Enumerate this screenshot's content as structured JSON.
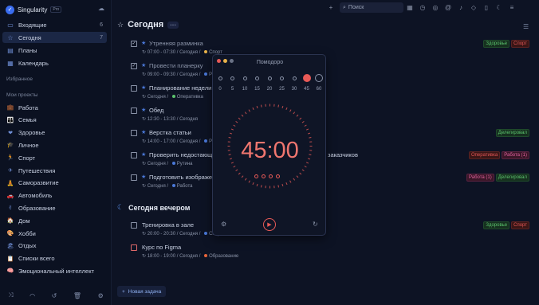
{
  "app": {
    "name": "Singularity",
    "badge": "Pro"
  },
  "sidebar": {
    "nav": [
      {
        "icon": "inbox-icon",
        "glyph": "▭",
        "label": "Входящие",
        "count": "6"
      },
      {
        "icon": "star-icon",
        "glyph": "☆",
        "label": "Сегодня",
        "count": "7"
      },
      {
        "icon": "plans-icon",
        "glyph": "▤",
        "label": "Планы",
        "count": ""
      },
      {
        "icon": "calendar-icon",
        "glyph": "▦",
        "label": "Календарь",
        "count": ""
      }
    ],
    "favorites_label": "Избранное",
    "projects_label": "Мои проекты",
    "projects": [
      {
        "icon": "briefcase-emoji",
        "glyph": "💼",
        "label": "Работа"
      },
      {
        "icon": "family-emoji",
        "glyph": "👪",
        "label": "Семья"
      },
      {
        "icon": "heart-emoji",
        "glyph": "❤",
        "label": "Здоровье"
      },
      {
        "icon": "hat-emoji",
        "glyph": "🎓",
        "label": "Личное"
      },
      {
        "icon": "sport-emoji",
        "glyph": "🏃",
        "label": "Спорт"
      },
      {
        "icon": "plane-emoji",
        "glyph": "✈",
        "label": "Путешествия"
      },
      {
        "icon": "selfdev-emoji",
        "glyph": "🧘",
        "label": "Саморазвитие"
      },
      {
        "icon": "car-emoji",
        "glyph": "🚗",
        "label": "Автомобиль"
      },
      {
        "icon": "hand-emoji",
        "glyph": "✌",
        "label": "Образование"
      },
      {
        "icon": "house-emoji",
        "glyph": "🏠",
        "label": "Дом"
      },
      {
        "icon": "palette-emoji",
        "glyph": "🎨",
        "label": "Хобби"
      },
      {
        "icon": "beach-emoji",
        "glyph": "🏖",
        "label": "Отдых"
      },
      {
        "icon": "list-emoji",
        "glyph": "📋",
        "label": "Списки всего"
      },
      {
        "icon": "brain-emoji",
        "glyph": "🧠",
        "label": "Эмоциональный интеллект"
      }
    ]
  },
  "topbar": {
    "search_placeholder": "Поиск"
  },
  "main": {
    "title": "Сегодня",
    "evening_title": "Сегодня вечером",
    "add_task": "Новая задача"
  },
  "tasks": [
    {
      "name": "Утренняя разминка",
      "done": true,
      "star": true,
      "meta": "07:00 - 07:30 / Сегодня",
      "project": "Спорт",
      "pcolor": "#e8b34a",
      "tags": [
        {
          "t": "Здоровье",
          "c": "green"
        },
        {
          "t": "Спорт",
          "c": "red"
        }
      ]
    },
    {
      "name": "Провести планерку",
      "done": true,
      "star": true,
      "meta": "09:00 - 09:30 / Сегодня",
      "project": "Работа",
      "pcolor": "#4a78d8",
      "tags": []
    },
    {
      "name": "Планирование недели",
      "done": false,
      "star": true,
      "meta": "Сегодня",
      "project": "Оперативка",
      "pcolor": "#5bc26d",
      "tags": []
    },
    {
      "name": "Обед",
      "done": false,
      "star": true,
      "meta": "12:30 - 13:30 / Сегодня",
      "project": "",
      "pcolor": "",
      "tags": []
    },
    {
      "name": "Верстка статьи",
      "done": false,
      "star": true,
      "meta": "14:00 - 17:00 / Сегодня",
      "project": "Работа",
      "pcolor": "#4a78d8",
      "tags": [
        {
          "t": "Делегировал",
          "c": "green"
        }
      ]
    },
    {
      "name": "Проверить недостающ",
      "done": false,
      "star": true,
      "meta": "Сегодня",
      "project": "Рутина",
      "pcolor": "#4a78d8",
      "tags": [
        {
          "t": "Оперативка",
          "c": "red"
        },
        {
          "t": "Работа (1)",
          "c": "pink"
        }
      ]
    },
    {
      "name": "Подготовить изображе",
      "done": false,
      "star": true,
      "meta": "Сегодня",
      "project": "Работа",
      "pcolor": "#4a78d8",
      "tags": [
        {
          "t": "Работа (1)",
          "c": "pink"
        },
        {
          "t": "Делегировал",
          "c": "green"
        }
      ]
    }
  ],
  "task_behind_popup": "заказчиков",
  "evening_tasks": [
    {
      "name": "Тренировка в зале",
      "red": false,
      "meta": "20:00 - 20:30 / Сегодня",
      "project": "Спорт",
      "pcolor": "#4a78d8",
      "tags": [
        {
          "t": "Здоровье",
          "c": "green"
        },
        {
          "t": "Спорт",
          "c": "red"
        }
      ]
    },
    {
      "name": "Курс по Figma",
      "red": true,
      "meta": "18:00 - 19:00 / Сегодня",
      "project": "Образование",
      "pcolor": "#e8653a",
      "tags": []
    }
  ],
  "pomodoro": {
    "title": "Помодоро",
    "options": [
      "0",
      "5",
      "10",
      "15",
      "20",
      "25",
      "30",
      "45",
      "60"
    ],
    "selected": "45",
    "time": "45:00",
    "sessions": 4,
    "accent": "#e85a57"
  }
}
